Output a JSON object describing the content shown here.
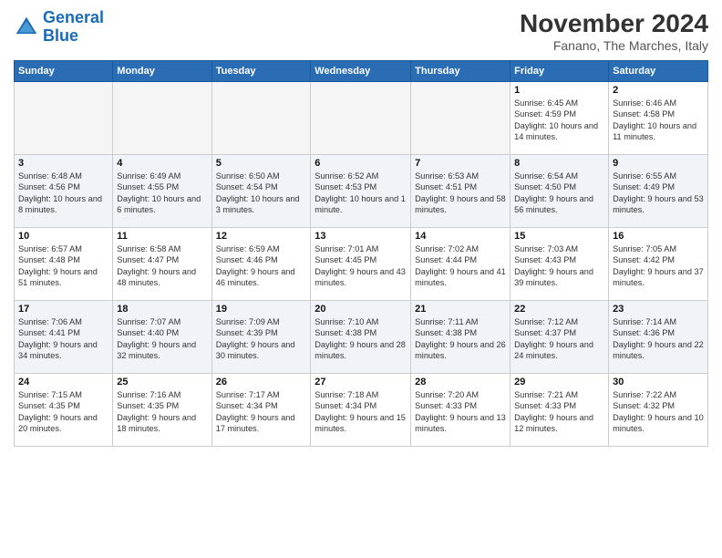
{
  "header": {
    "logo_line1": "General",
    "logo_line2": "Blue",
    "month": "November 2024",
    "location": "Fanano, The Marches, Italy"
  },
  "weekdays": [
    "Sunday",
    "Monday",
    "Tuesday",
    "Wednesday",
    "Thursday",
    "Friday",
    "Saturday"
  ],
  "rows": [
    [
      {
        "day": "",
        "info": ""
      },
      {
        "day": "",
        "info": ""
      },
      {
        "day": "",
        "info": ""
      },
      {
        "day": "",
        "info": ""
      },
      {
        "day": "",
        "info": ""
      },
      {
        "day": "1",
        "info": "Sunrise: 6:45 AM\nSunset: 4:59 PM\nDaylight: 10 hours and 14 minutes."
      },
      {
        "day": "2",
        "info": "Sunrise: 6:46 AM\nSunset: 4:58 PM\nDaylight: 10 hours and 11 minutes."
      }
    ],
    [
      {
        "day": "3",
        "info": "Sunrise: 6:48 AM\nSunset: 4:56 PM\nDaylight: 10 hours and 8 minutes."
      },
      {
        "day": "4",
        "info": "Sunrise: 6:49 AM\nSunset: 4:55 PM\nDaylight: 10 hours and 6 minutes."
      },
      {
        "day": "5",
        "info": "Sunrise: 6:50 AM\nSunset: 4:54 PM\nDaylight: 10 hours and 3 minutes."
      },
      {
        "day": "6",
        "info": "Sunrise: 6:52 AM\nSunset: 4:53 PM\nDaylight: 10 hours and 1 minute."
      },
      {
        "day": "7",
        "info": "Sunrise: 6:53 AM\nSunset: 4:51 PM\nDaylight: 9 hours and 58 minutes."
      },
      {
        "day": "8",
        "info": "Sunrise: 6:54 AM\nSunset: 4:50 PM\nDaylight: 9 hours and 56 minutes."
      },
      {
        "day": "9",
        "info": "Sunrise: 6:55 AM\nSunset: 4:49 PM\nDaylight: 9 hours and 53 minutes."
      }
    ],
    [
      {
        "day": "10",
        "info": "Sunrise: 6:57 AM\nSunset: 4:48 PM\nDaylight: 9 hours and 51 minutes."
      },
      {
        "day": "11",
        "info": "Sunrise: 6:58 AM\nSunset: 4:47 PM\nDaylight: 9 hours and 48 minutes."
      },
      {
        "day": "12",
        "info": "Sunrise: 6:59 AM\nSunset: 4:46 PM\nDaylight: 9 hours and 46 minutes."
      },
      {
        "day": "13",
        "info": "Sunrise: 7:01 AM\nSunset: 4:45 PM\nDaylight: 9 hours and 43 minutes."
      },
      {
        "day": "14",
        "info": "Sunrise: 7:02 AM\nSunset: 4:44 PM\nDaylight: 9 hours and 41 minutes."
      },
      {
        "day": "15",
        "info": "Sunrise: 7:03 AM\nSunset: 4:43 PM\nDaylight: 9 hours and 39 minutes."
      },
      {
        "day": "16",
        "info": "Sunrise: 7:05 AM\nSunset: 4:42 PM\nDaylight: 9 hours and 37 minutes."
      }
    ],
    [
      {
        "day": "17",
        "info": "Sunrise: 7:06 AM\nSunset: 4:41 PM\nDaylight: 9 hours and 34 minutes."
      },
      {
        "day": "18",
        "info": "Sunrise: 7:07 AM\nSunset: 4:40 PM\nDaylight: 9 hours and 32 minutes."
      },
      {
        "day": "19",
        "info": "Sunrise: 7:09 AM\nSunset: 4:39 PM\nDaylight: 9 hours and 30 minutes."
      },
      {
        "day": "20",
        "info": "Sunrise: 7:10 AM\nSunset: 4:38 PM\nDaylight: 9 hours and 28 minutes."
      },
      {
        "day": "21",
        "info": "Sunrise: 7:11 AM\nSunset: 4:38 PM\nDaylight: 9 hours and 26 minutes."
      },
      {
        "day": "22",
        "info": "Sunrise: 7:12 AM\nSunset: 4:37 PM\nDaylight: 9 hours and 24 minutes."
      },
      {
        "day": "23",
        "info": "Sunrise: 7:14 AM\nSunset: 4:36 PM\nDaylight: 9 hours and 22 minutes."
      }
    ],
    [
      {
        "day": "24",
        "info": "Sunrise: 7:15 AM\nSunset: 4:35 PM\nDaylight: 9 hours and 20 minutes."
      },
      {
        "day": "25",
        "info": "Sunrise: 7:16 AM\nSunset: 4:35 PM\nDaylight: 9 hours and 18 minutes."
      },
      {
        "day": "26",
        "info": "Sunrise: 7:17 AM\nSunset: 4:34 PM\nDaylight: 9 hours and 17 minutes."
      },
      {
        "day": "27",
        "info": "Sunrise: 7:18 AM\nSunset: 4:34 PM\nDaylight: 9 hours and 15 minutes."
      },
      {
        "day": "28",
        "info": "Sunrise: 7:20 AM\nSunset: 4:33 PM\nDaylight: 9 hours and 13 minutes."
      },
      {
        "day": "29",
        "info": "Sunrise: 7:21 AM\nSunset: 4:33 PM\nDaylight: 9 hours and 12 minutes."
      },
      {
        "day": "30",
        "info": "Sunrise: 7:22 AM\nSunset: 4:32 PM\nDaylight: 9 hours and 10 minutes."
      }
    ]
  ]
}
